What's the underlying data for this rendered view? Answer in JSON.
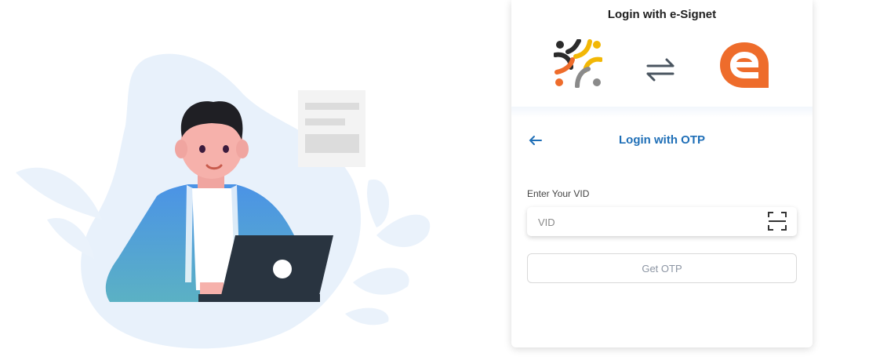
{
  "header": {
    "title": "Login with e-Signet"
  },
  "logos": {
    "left_icon": "partner-logo-icon",
    "swap_icon": "swap-arrows-icon",
    "right_icon": "esignet-logo-icon",
    "accent_orange": "#ee6c2b",
    "accent_yellow": "#f2b705",
    "accent_dark": "#2b2b2b",
    "accent_gray": "#8a8a8a"
  },
  "login_section": {
    "back_icon": "back-arrow-icon",
    "title": "Login with OTP",
    "field_label": "Enter Your VID",
    "vid_placeholder": "VID",
    "vid_value": "",
    "scan_icon": "qr-scan-icon",
    "submit_label": "Get OTP",
    "link_color": "#1f6fb7"
  },
  "illustration": {
    "subject": "person-with-laptop",
    "blob_color": "#e8f1fb"
  }
}
